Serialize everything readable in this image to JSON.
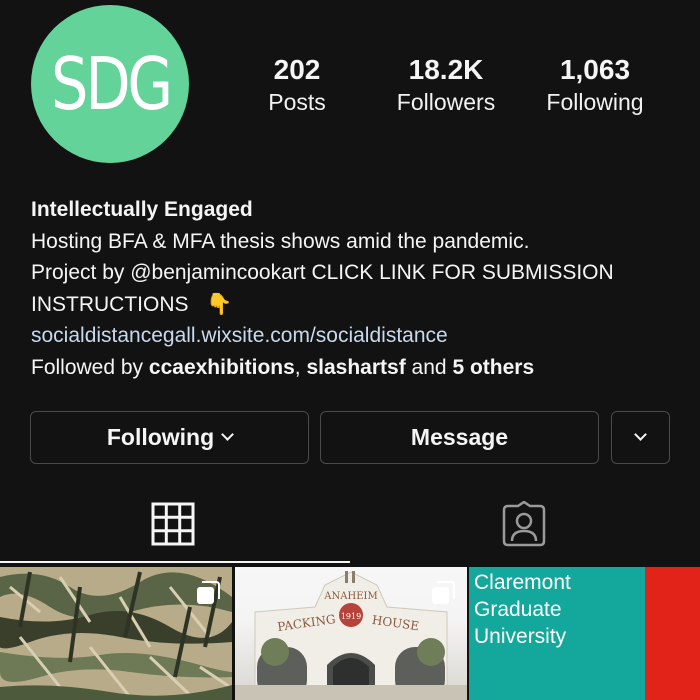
{
  "profile": {
    "avatar_text": "SDG",
    "avatar_color": "#63d39a"
  },
  "stats": {
    "posts": {
      "value": "202",
      "label": "Posts"
    },
    "followers": {
      "value": "18.2K",
      "label": "Followers"
    },
    "following": {
      "value": "1,063",
      "label": "Following"
    }
  },
  "bio": {
    "name": "Intellectually Engaged",
    "line1": "Hosting BFA & MFA thesis shows amid the pandemic.",
    "line2": "Project by @benjamincookart CLICK LINK FOR SUBMISSION",
    "line3": "INSTRUCTIONS",
    "line3_emoji": "👇",
    "link": "socialdistancegall.wixsite.com/socialdistance",
    "followed_by_prefix": "Followed by",
    "followed_by_user1": "ccaexhibitions",
    "followed_by_sep": ",",
    "followed_by_user2": "slashartsf",
    "followed_by_and": "and",
    "followed_by_others": "5 others"
  },
  "actions": {
    "following_label": "Following",
    "message_label": "Message",
    "more_icon": "chevron-down-icon"
  },
  "tabs": {
    "grid_icon": "grid-icon",
    "tagged_icon": "tagged-person-icon"
  },
  "grid": {
    "tile3_text": [
      "Claremont",
      "Graduate",
      "University"
    ],
    "tile3_color": "#14a89c",
    "tile3_accent": "#e2231a",
    "tile2_sign": [
      "ANAHEIM",
      "PACKING",
      "HOUSE"
    ]
  }
}
